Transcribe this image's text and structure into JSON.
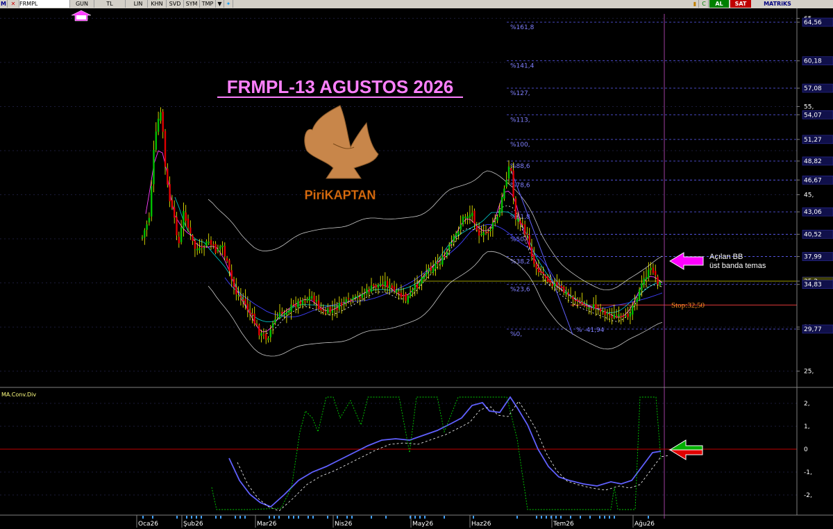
{
  "toolbar": {
    "logo": "M",
    "symbol": "FRMPL",
    "period": "GUN",
    "currency": "TL",
    "buttons": [
      "LIN",
      "KHN",
      "SVD",
      "SYM",
      "TMP"
    ],
    "al": "AL",
    "sat": "SAT",
    "matriks": "MATRiKS"
  },
  "title": "FRMPL-13 AGUSTOS 2026",
  "logo_text": "PiriKAPTAN",
  "annotations": {
    "bb_note": "Açılan BB üst banda temas",
    "stop": "Stop:32,50",
    "drop_label": "% -41,94"
  },
  "colors": {
    "up": "#00c000",
    "down": "#e00000",
    "wick": "#ffff00",
    "fib": "#6060ff",
    "bb": "#c8c8c8",
    "macd": "#6060ff",
    "title": "#ff80ff",
    "accent_arrow": "#ff00ff",
    "stop": "#ff9020"
  },
  "chart_data": [
    {
      "type": "candlestick",
      "title": "FRMPL-13 AGUSTOS 2026",
      "ylim": [
        22.5,
        65.5
      ],
      "y_tick_labels": [
        "65,",
        "64,56",
        "60,18",
        "57,08",
        "55,",
        "54,07",
        "51,27",
        "48,82",
        "46,67",
        "45,",
        "43,06",
        "40,52",
        "37,99",
        "35,2",
        "34,83",
        "30,",
        "29,77",
        "25,"
      ],
      "x_tick_labels": [
        "Oca26",
        "Şub26",
        "Mar26",
        "Nis26",
        "May26",
        "Haz26",
        "Tem26",
        "Ağu26"
      ],
      "fib_levels": [
        {
          "label": "%161,8",
          "value": 64.56
        },
        {
          "label": "%141,4",
          "value": 60.18
        },
        {
          "label": "%127,",
          "value": 57.08
        },
        {
          "label": "%113,",
          "value": 54.07
        },
        {
          "label": "%100,",
          "value": 51.27
        },
        {
          "label": "%88,6",
          "value": 48.82
        },
        {
          "label": "%78,6",
          "value": 46.67
        },
        {
          "label": "%61,8",
          "value": 43.06
        },
        {
          "label": "%50,",
          "value": 40.52
        },
        {
          "label": "%38,2",
          "value": 37.99
        },
        {
          "label": "%23,6",
          "value": 34.83
        },
        {
          "label": "%0,",
          "value": 29.77
        }
      ],
      "last_price": 35.2,
      "stop": 32.5
    },
    {
      "type": "line",
      "title": "MA.Conv.Div",
      "ylim": [
        -2.6,
        2.6
      ],
      "y_tick_labels": [
        "2,",
        "1,",
        "0",
        "-1,",
        "-2,"
      ]
    }
  ]
}
